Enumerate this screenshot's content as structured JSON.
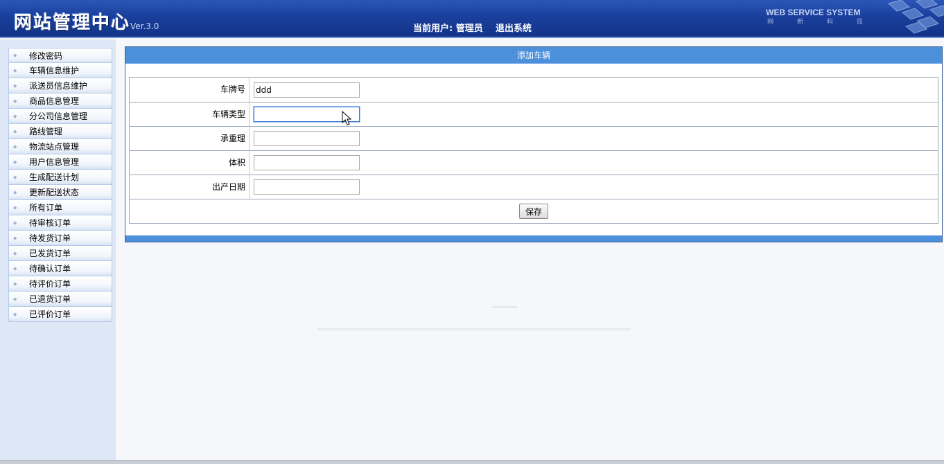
{
  "header": {
    "title": "网站管理中心",
    "version": "Ver.3.0",
    "current_user": "当前用户: 管理员",
    "logout": "退出系统",
    "brand_en": "WEB SERVICE SYSTEM",
    "brand_cn": [
      "网",
      "新",
      "科",
      "技"
    ]
  },
  "sidebar": {
    "items": [
      {
        "label": "修改密码"
      },
      {
        "label": "车辆信息维护"
      },
      {
        "label": "派送员信息维护"
      },
      {
        "label": "商品信息管理"
      },
      {
        "label": "分公司信息管理"
      },
      {
        "label": "路线管理"
      },
      {
        "label": "物流站点管理"
      },
      {
        "label": "用户信息管理"
      },
      {
        "label": "生成配送计划"
      },
      {
        "label": "更新配送状态"
      },
      {
        "label": "所有订单"
      },
      {
        "label": "待审核订单"
      },
      {
        "label": "待发货订单"
      },
      {
        "label": "已发货订单"
      },
      {
        "label": "待确认订单"
      },
      {
        "label": "待评价订单"
      },
      {
        "label": "已退货订单"
      },
      {
        "label": "已评价订单"
      }
    ]
  },
  "form": {
    "title": "添加车辆",
    "fields": [
      {
        "label": "车牌号",
        "value": "ddd"
      },
      {
        "label": "车辆类型",
        "value": ""
      },
      {
        "label": "承重理",
        "value": ""
      },
      {
        "label": "体积",
        "value": ""
      },
      {
        "label": "出产日期",
        "value": ""
      }
    ],
    "save_label": "保存"
  }
}
